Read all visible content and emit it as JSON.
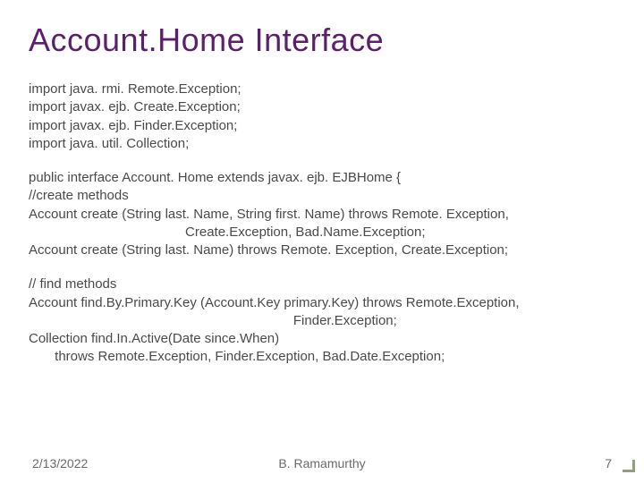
{
  "title": "Account.Home Interface",
  "imports": [
    "import java. rmi. Remote.Exception;",
    "import javax. ejb. Create.Exception;",
    "import javax. ejb. Finder.Exception;",
    "import java. util. Collection;"
  ],
  "create_block": [
    "public interface Account. Home extends javax. ejb. EJBHome {",
    "//create methods",
    "Account create (String last. Name, String first. Name) throws Remote. Exception,",
    "                                          Create.Exception, Bad.Name.Exception;",
    "Account create (String last. Name) throws Remote. Exception, Create.Exception;"
  ],
  "find_block": [
    "// find methods",
    "Account find.By.Primary.Key (Account.Key primary.Key) throws Remote.Exception,",
    "                                                                       Finder.Exception;",
    "Collection find.In.Active(Date since.When)",
    "       throws Remote.Exception, Finder.Exception, Bad.Date.Exception;"
  ],
  "footer": {
    "date": "2/13/2022",
    "author": "B. Ramamurthy",
    "page": "7"
  }
}
